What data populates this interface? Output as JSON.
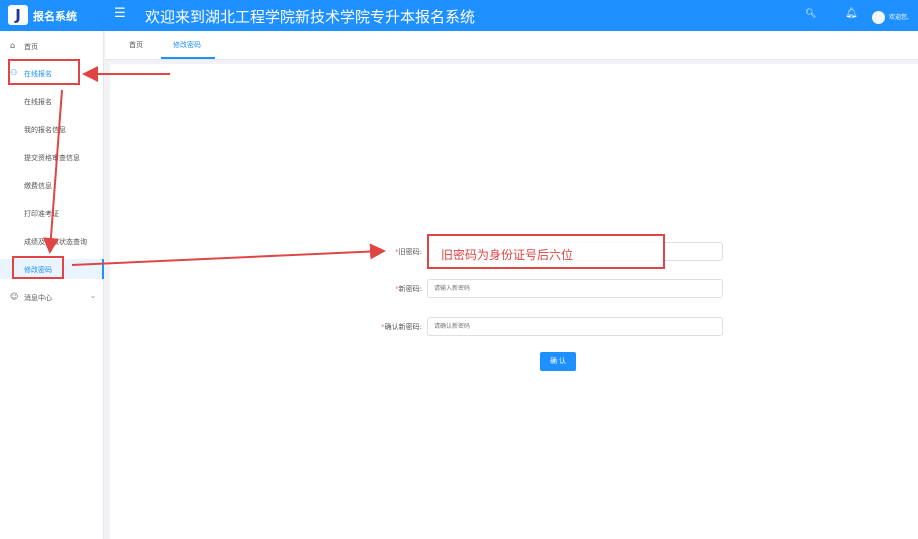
{
  "header": {
    "logo_letter": "J",
    "app_name": "报名系统",
    "welcome": "欢迎来到湖北工程学院新技术学院专升本报名系统",
    "user": "欢迎您,"
  },
  "sidebar": {
    "home": "首页",
    "online_reg": "在线报名",
    "sub_items": [
      "在线报名",
      "我的报名信息",
      "提交资格审查信息",
      "缴费信息",
      "打印准考证",
      "成绩及录取状态查询",
      "修改密码"
    ],
    "messages": "消息中心"
  },
  "tabs": [
    "首页",
    "修改密码"
  ],
  "form": {
    "old_label": "旧密码:",
    "old_placeholder": "",
    "new_label": "新密码:",
    "new_placeholder": "请输入新密码",
    "confirm_label": "确认新密码:",
    "confirm_placeholder": "请确认新密码",
    "required_mark": "*",
    "submit": "确 认"
  },
  "annotation": {
    "note": "旧密码为身份证号后六位"
  },
  "colors": {
    "primary": "#1e90ff",
    "annotation_red": "#e04545"
  }
}
